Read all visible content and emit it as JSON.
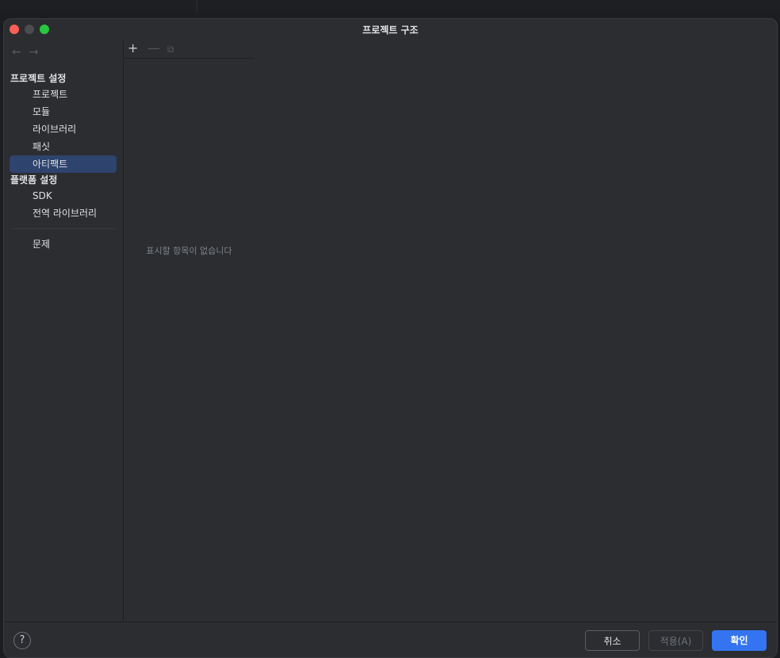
{
  "window": {
    "title": "프로젝트 구조"
  },
  "nav": {
    "back_icon": "arrow-left-icon",
    "forward_icon": "arrow-right-icon",
    "back": "←",
    "forward": "→"
  },
  "sidebar": {
    "project_settings_header": "프로젝트 설정",
    "project_items": [
      "프로젝트",
      "모듈",
      "라이브러리",
      "패싯",
      "아티팩트"
    ],
    "selected": "아티팩트",
    "platform_settings_header": "플랫폼 설정",
    "platform_items": [
      "SDK",
      "전역 라이브러리"
    ],
    "problems": "문제"
  },
  "toolbar": {
    "add": "+",
    "remove": "—",
    "copy": "⧉",
    "add_icon": "plus-icon",
    "remove_icon": "minus-icon",
    "copy_icon": "copy-icon"
  },
  "list": {
    "empty_text": "표시할 항목이 없습니다"
  },
  "footer": {
    "help": "?",
    "cancel": "취소",
    "apply": "적용(A)",
    "ok": "확인"
  },
  "colors": {
    "accent": "#3574f0",
    "selection": "#2e436e",
    "background": "#2b2d30"
  }
}
